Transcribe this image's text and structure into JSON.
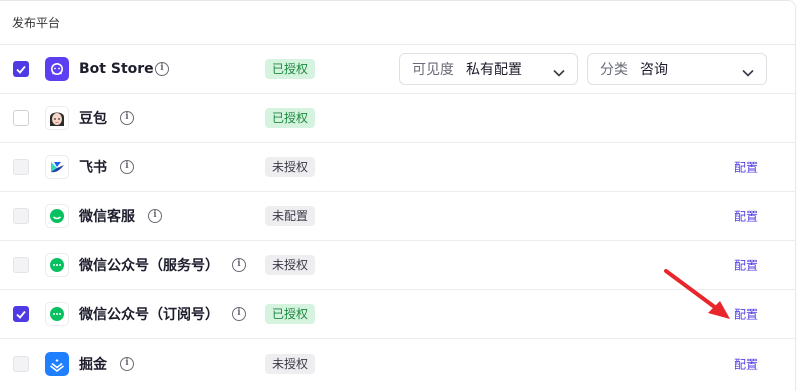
{
  "header": {
    "title": "发布平台"
  },
  "visibility": {
    "label": "可见度",
    "value": "私有配置"
  },
  "category": {
    "label": "分类",
    "value": "咨询"
  },
  "rows": [
    {
      "name": "Bot Store",
      "status": "已授权",
      "config": ""
    },
    {
      "name": "豆包",
      "status": "已授权",
      "config": ""
    },
    {
      "name": "飞书",
      "status": "未授权",
      "config": "配置"
    },
    {
      "name": "微信客服",
      "status": "未配置",
      "config": "配置"
    },
    {
      "name": "微信公众号（服务号）",
      "status": "未授权",
      "config": "配置"
    },
    {
      "name": "微信公众号（订阅号）",
      "status": "已授权",
      "config": "配置"
    },
    {
      "name": "掘金",
      "status": "未授权",
      "config": "配置"
    }
  ],
  "info_glyph": "i",
  "colors": {
    "accent": "#4f3be3",
    "authorized_bg": "#d6f3df",
    "authorized_text": "#1a8a3e",
    "arrow": "#e8262b"
  }
}
